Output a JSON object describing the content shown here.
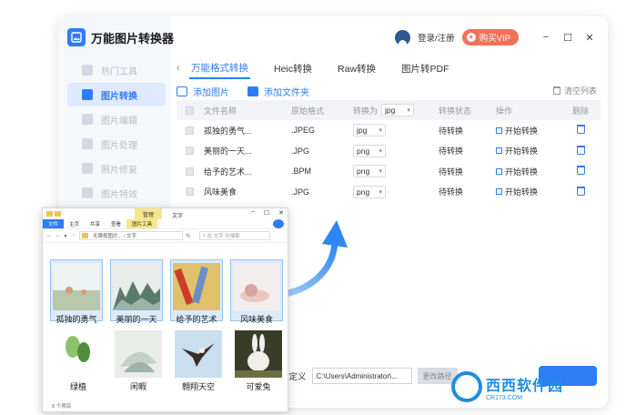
{
  "app": {
    "title": "万能图片转换器",
    "login": "登录/注册",
    "vip": "购买VIP",
    "window_controls": [
      "−",
      "☐",
      "✕"
    ]
  },
  "sidebar": {
    "items": [
      {
        "label": "热门工具",
        "active": false
      },
      {
        "label": "图片转换",
        "active": true
      },
      {
        "label": "图片编辑",
        "active": false
      },
      {
        "label": "图片处理",
        "active": false
      },
      {
        "label": "照片修复",
        "active": false
      },
      {
        "label": "图片特效",
        "active": false
      }
    ]
  },
  "tabs": [
    {
      "label": "万能格式转换",
      "active": true
    },
    {
      "label": "Heic转换",
      "active": false
    },
    {
      "label": "Raw转换",
      "active": false
    },
    {
      "label": "图片转PDF",
      "active": false
    }
  ],
  "actions": {
    "add_image": "添加图片",
    "add_folder": "添加文件夹",
    "clear_list": "清空列表"
  },
  "table": {
    "headers": {
      "name": "文件名称",
      "format": "原始格式",
      "convert_to": "转换为",
      "convert_to_value": "jpg",
      "status": "转换状态",
      "operation": "操作",
      "delete": "删除"
    },
    "rows": [
      {
        "name": "孤独的勇气...",
        "format": ".JPEG",
        "target": "jpg",
        "status": "待转换",
        "op": "开始转换"
      },
      {
        "name": "美丽的一天...",
        "format": ".JPG",
        "target": "png",
        "status": "待转换",
        "op": "开始转换"
      },
      {
        "name": "给予的艺术...",
        "format": ".BPM",
        "target": "png",
        "status": "待转换",
        "op": "开始转换"
      },
      {
        "name": "风味美食",
        "format": ".JPG",
        "target": "png",
        "status": "待转换",
        "op": "开始转换"
      }
    ]
  },
  "output": {
    "label": "自定义",
    "path": "C:\\Users\\Administrator\\...",
    "change_btn": "更改路径"
  },
  "explorer": {
    "manage": "管理",
    "folder_title": "文字",
    "ribbon": [
      "文件",
      "主页",
      "共享",
      "查看",
      "图片工具"
    ],
    "path": "无限视图片... › 文字",
    "search": "在 文字 中搜索",
    "count": "8 个项目",
    "items": [
      {
        "label": "孤独的勇气",
        "selected": true,
        "colors": [
          "#eef3f3",
          "#b7c9a8",
          "#d79a7e"
        ]
      },
      {
        "label": "美丽的一天",
        "selected": true,
        "colors": [
          "#e8eceb",
          "#5b7a6e",
          "#9eb3a8"
        ]
      },
      {
        "label": "给予的艺术",
        "selected": true,
        "colors": [
          "#e0c16a",
          "#cf3b2a",
          "#6a8fc4"
        ]
      },
      {
        "label": "风味美食",
        "selected": true,
        "colors": [
          "#f3eeee",
          "#d6a6a0",
          "#e7c9c1"
        ]
      },
      {
        "label": "绿植",
        "selected": false,
        "colors": [
          "#ffffff",
          "#8cc26b",
          "#4f8f3a"
        ]
      },
      {
        "label": "闲暇",
        "selected": false,
        "colors": [
          "#e9ece8",
          "#c3cfc7",
          "#9fb1a8"
        ]
      },
      {
        "label": "翱翔天空",
        "selected": false,
        "colors": [
          "#c9dff0",
          "#3b2d24",
          "#f2f2f2"
        ]
      },
      {
        "label": "可爱兔",
        "selected": false,
        "colors": [
          "#3a3c2a",
          "#f1efec",
          "#6b6d44"
        ]
      }
    ]
  },
  "watermark": {
    "brand": "西西软件园",
    "url": "CR173.COM"
  },
  "colors": {
    "accent": "#2e7cf6",
    "vip": "#f2705a",
    "sidebar_active_bg": "#dfe9ff"
  }
}
